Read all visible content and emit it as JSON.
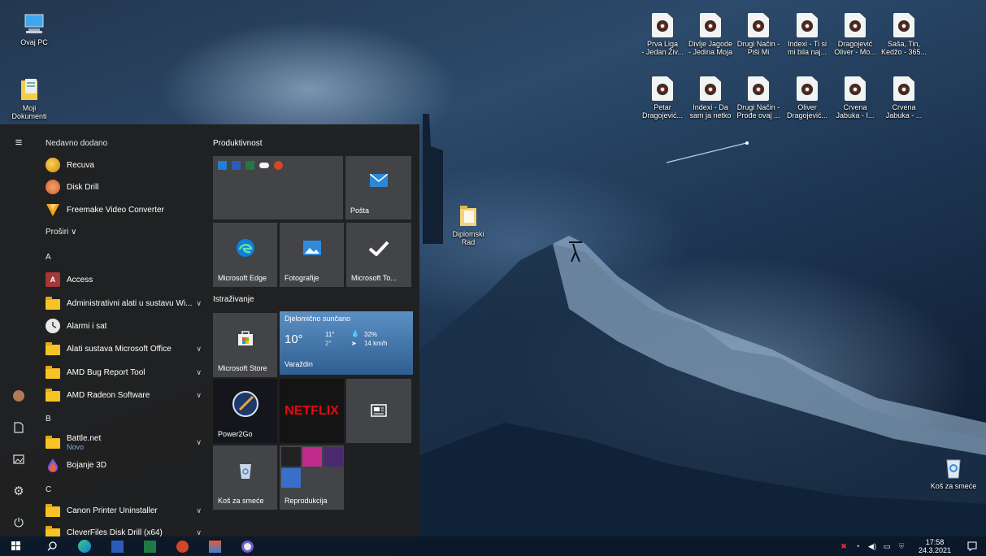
{
  "desktop": {
    "icons_left": [
      {
        "label": "Ovaj PC",
        "icon": "computer-icon"
      },
      {
        "label": "Moji\nDokumenti",
        "icon": "documents-icon"
      }
    ],
    "media_row1": [
      {
        "label": "Prva Liga\n- Jedan Živ..."
      },
      {
        "label": "Divlje Jagode\n- Jedina Moja"
      },
      {
        "label": "Drugi Način -\nPiši Mi"
      },
      {
        "label": "Indexi - Ti si\nmi bila naj..."
      },
      {
        "label": "Dragojević\nOliver - Mo..."
      },
      {
        "label": "Saša, Tin,\nKedžo - 365..."
      }
    ],
    "media_row2": [
      {
        "label": "Petar\nDragojević..."
      },
      {
        "label": "Indexi - Da\nsam ja netko"
      },
      {
        "label": "Drugi Način -\nProđe ovaj ..."
      },
      {
        "label": "Oliver\nDragojević..."
      },
      {
        "label": "Crvena\nJabuka - I..."
      },
      {
        "label": "Crvena\nJabuka - ..."
      }
    ],
    "folder_icon": {
      "label": "Diplomski\nRad"
    },
    "recycle_bin": {
      "label": "Koš za smeće"
    }
  },
  "start_menu": {
    "recent_header": "Nedavno dodano",
    "recent": [
      {
        "label": "Recuva",
        "icon": "recuva-icon"
      },
      {
        "label": "Disk Drill",
        "icon": "disk-drill-icon"
      },
      {
        "label": "Freemake Video Converter",
        "icon": "freemake-icon"
      }
    ],
    "expand": "Proširi ∨",
    "letter_a": "A",
    "apps_a": [
      {
        "label": "Access",
        "icon": "access-icon",
        "folder": false,
        "chevron": false
      },
      {
        "label": "Administrativni alati u sustavu Wi...",
        "icon": "folder-icon",
        "folder": true,
        "chevron": true
      },
      {
        "label": "Alarmi i sat",
        "icon": "alarm-clock-icon",
        "folder": false,
        "chevron": false
      },
      {
        "label": "Alati sustava Microsoft Office",
        "icon": "folder-icon",
        "folder": true,
        "chevron": true
      },
      {
        "label": "AMD Bug Report Tool",
        "icon": "folder-icon",
        "folder": true,
        "chevron": true
      },
      {
        "label": "AMD Radeon Software",
        "icon": "folder-icon",
        "folder": true,
        "chevron": true
      }
    ],
    "letter_b": "B",
    "apps_b": [
      {
        "label": "Battle.net",
        "sub": "Novo",
        "icon": "folder-icon",
        "folder": true,
        "chevron": true
      },
      {
        "label": "Bojanje 3D",
        "icon": "paint3d-icon",
        "folder": false,
        "chevron": false
      }
    ],
    "letter_c": "C",
    "apps_c": [
      {
        "label": "Canon Printer Uninstaller",
        "icon": "folder-icon",
        "folder": true,
        "chevron": true
      },
      {
        "label": "CleverFiles Disk Drill (x64)",
        "icon": "folder-icon",
        "folder": true,
        "chevron": true
      }
    ],
    "groups": {
      "productivity": "Produktivnost",
      "explore": "Istraživanje"
    },
    "tiles": {
      "mail": "Pošta",
      "edge": "Microsoft Edge",
      "photos": "Fotografije",
      "todo": "Microsoft To...",
      "store": "Microsoft Store",
      "power2go": "Power2Go",
      "netflix": "NETFLIX",
      "recycle": "Koš za smeće",
      "play": "Reprodukcija"
    },
    "weather": {
      "condition": "Djelomično sunčano",
      "temp": "10°",
      "high": "11°",
      "low": "2°",
      "humidity": "32%",
      "wind": "14 km/h",
      "city": "Varaždin"
    }
  },
  "taskbar": {
    "time": "17:58",
    "date": "24.3.2021"
  }
}
